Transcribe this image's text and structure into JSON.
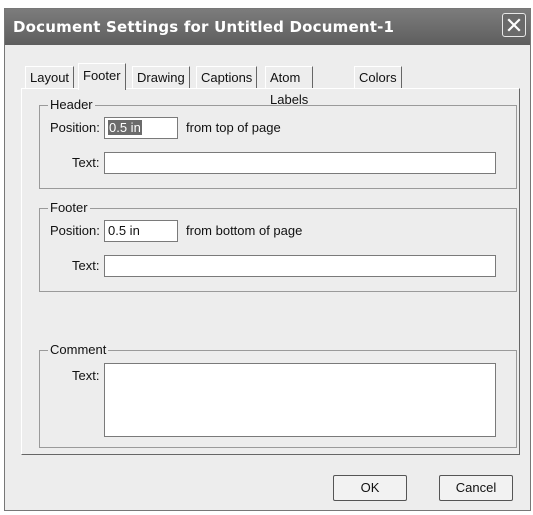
{
  "window": {
    "title": "Document Settings for Untitled Document-1",
    "close_icon": "close-icon"
  },
  "tabs": [
    {
      "label": "Layout",
      "active": false
    },
    {
      "label": "Footer",
      "active": true
    },
    {
      "label": "Drawing",
      "active": false
    },
    {
      "label": "Captions",
      "active": false
    },
    {
      "label": "Atom Labels",
      "active": false
    },
    {
      "label": "Colors",
      "active": false
    }
  ],
  "header_group": {
    "label": "Header",
    "position_label": "Position:",
    "position_value": "0.5 in",
    "position_suffix": "from top of page",
    "text_label": "Text:",
    "text_value": ""
  },
  "footer_group": {
    "label": "Footer",
    "position_label": "Position:",
    "position_value": "0.5 in",
    "position_suffix": "from bottom of page",
    "text_label": "Text:",
    "text_value": ""
  },
  "comment_group": {
    "label": "Comment",
    "text_label": "Text:",
    "text_value": ""
  },
  "buttons": {
    "ok": "OK",
    "cancel": "Cancel"
  }
}
